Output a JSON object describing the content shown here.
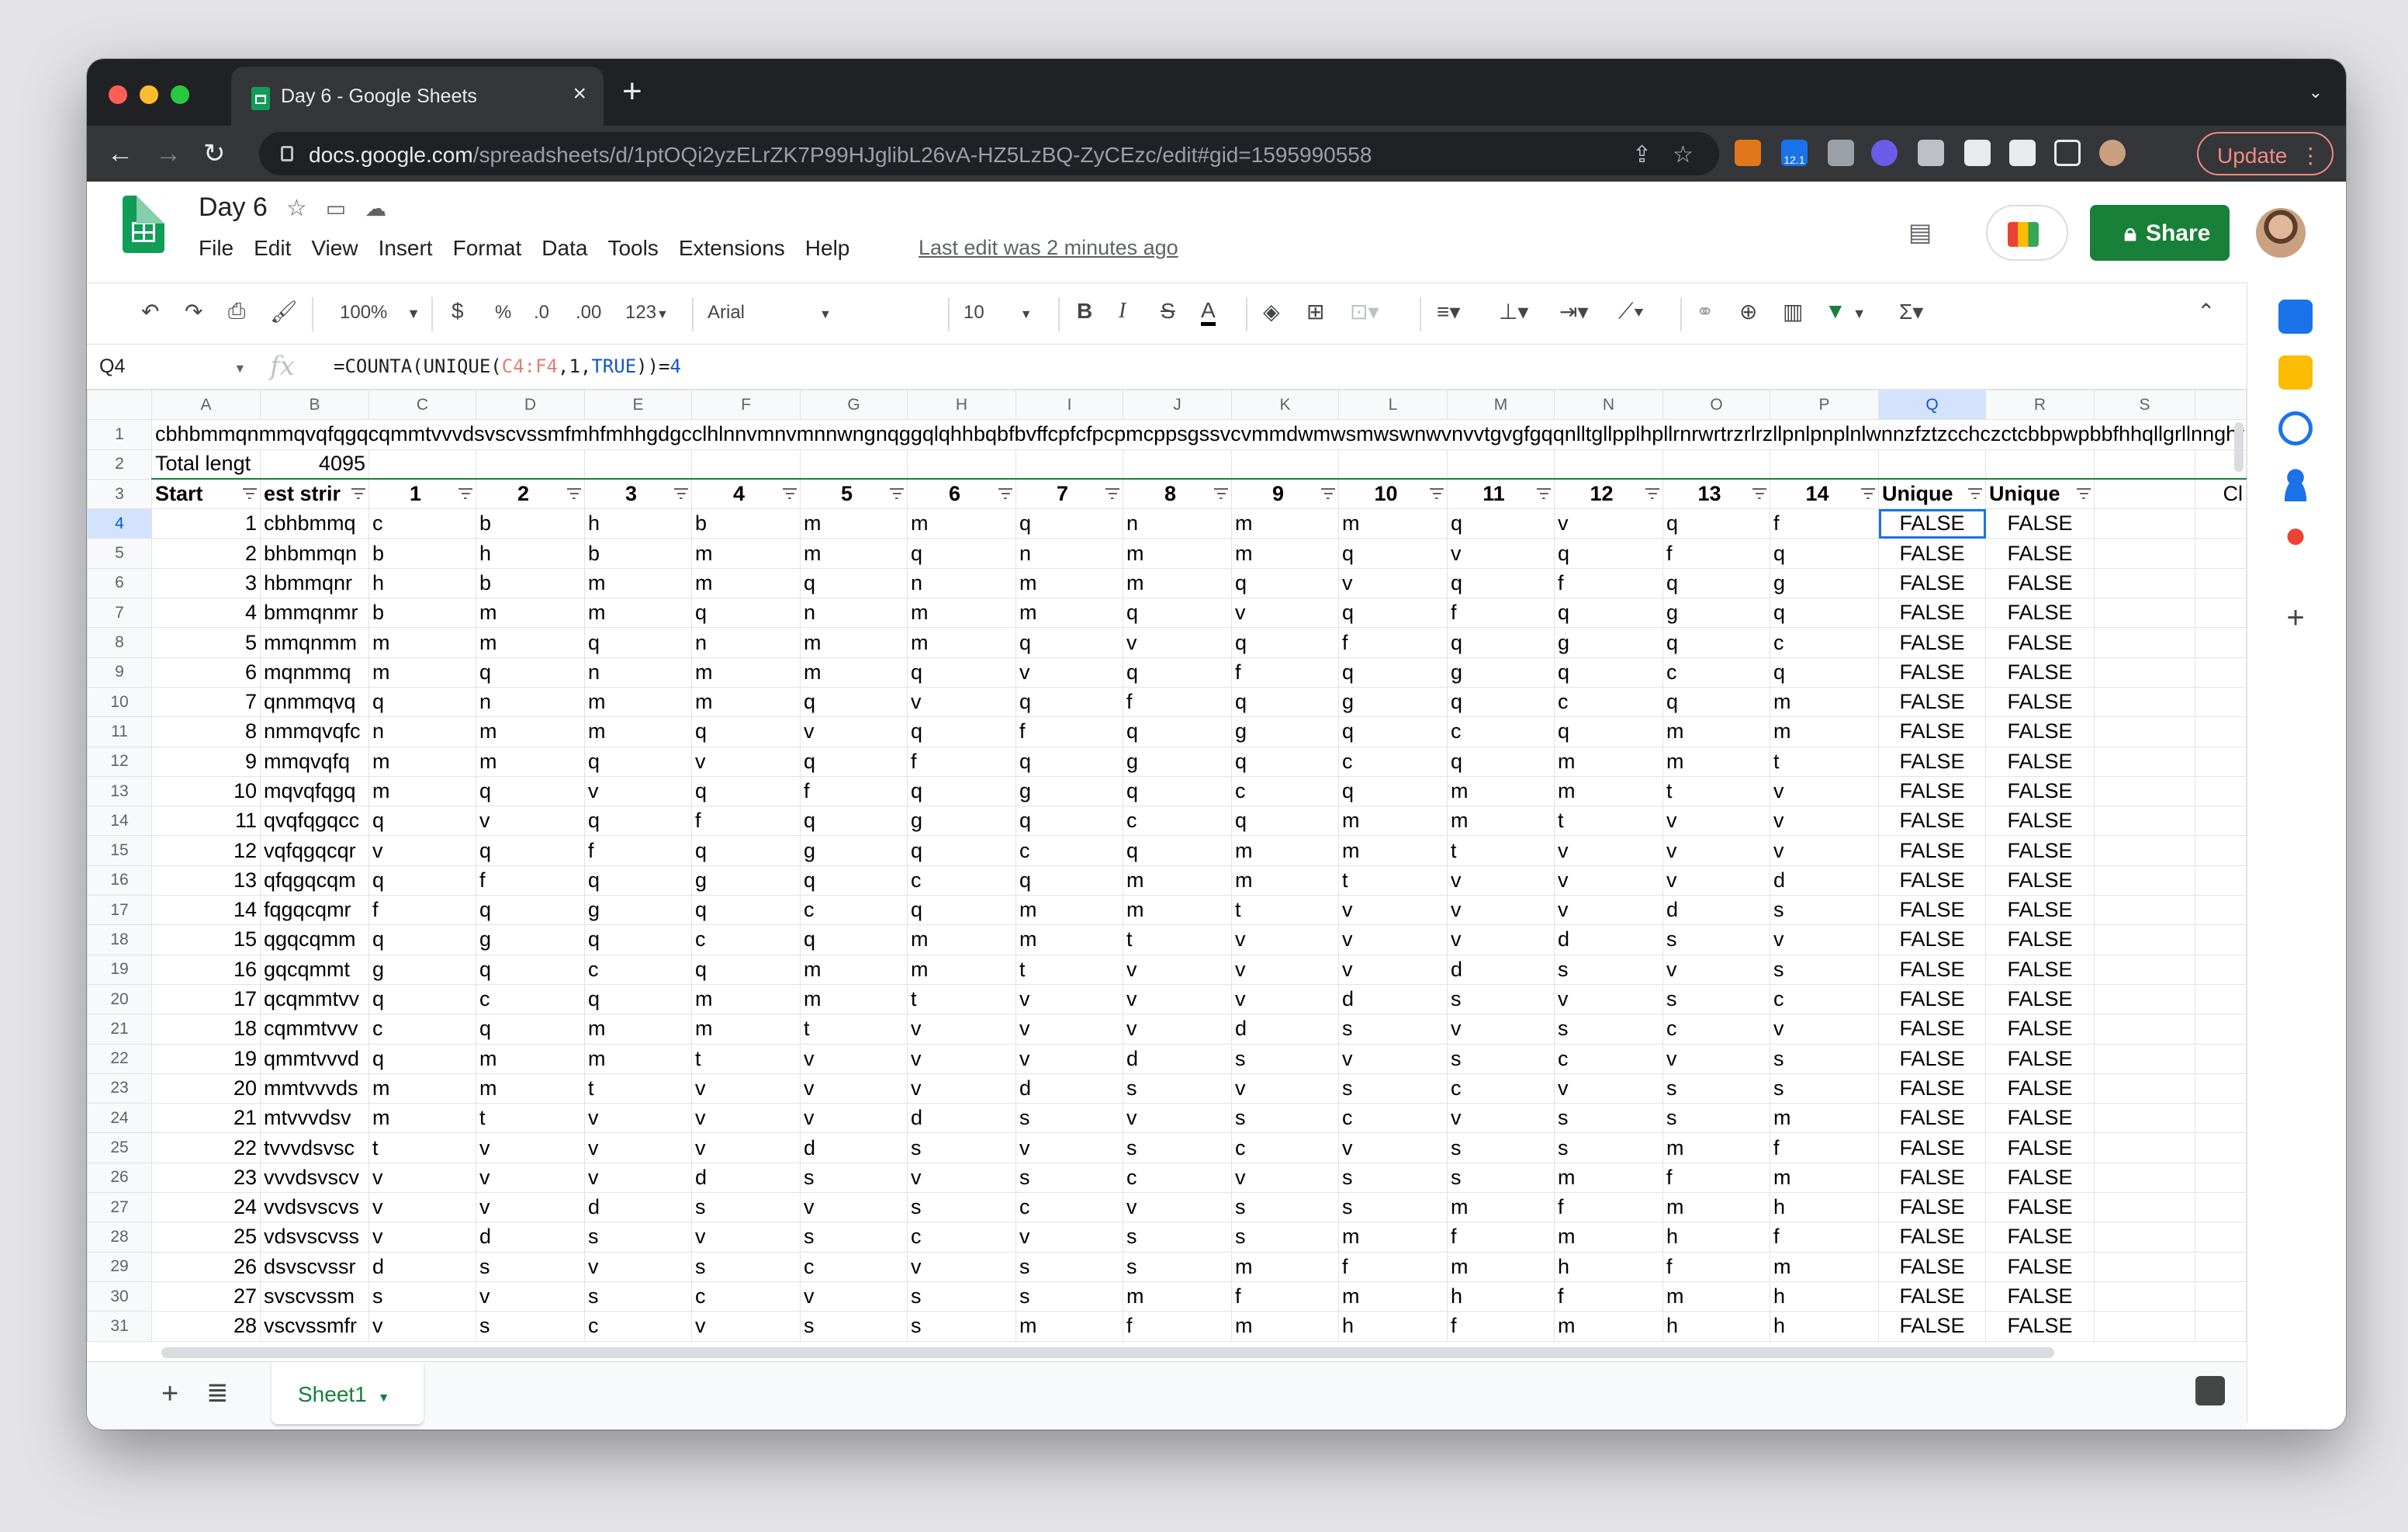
{
  "browser": {
    "tab_title": "Day 6 - Google Sheets",
    "url_host": "docs.google.com",
    "url_path": "/spreadsheets/d/1ptOQi2yzELrZK7P99HJglibL26vA-HZ5LzBQ-ZyCEzc/edit#gid=1595990558",
    "update_label": "Update",
    "ext_badge": "12.1"
  },
  "doc": {
    "title": "Day 6",
    "menus": [
      "File",
      "Edit",
      "View",
      "Insert",
      "Format",
      "Data",
      "Tools",
      "Extensions",
      "Help"
    ],
    "last_edit": "Last edit was 2 minutes ago",
    "share_label": "Share"
  },
  "format_bar": {
    "zoom": "100%",
    "currency": "$",
    "percent": "%",
    "dec_less": ".0",
    "dec_more": ".00",
    "more_formats": "123",
    "font": "Arial",
    "font_size": "10"
  },
  "formula_bar": {
    "cell_ref": "Q4",
    "fx": "fx",
    "formula_prefix": "=COUNTA(UNIQUE(",
    "formula_ref": "C4:F4",
    "formula_mid": ",1,",
    "formula_bool": "TRUE",
    "formula_end": "))=",
    "formula_num": "4"
  },
  "grid": {
    "columns": [
      "A",
      "B",
      "C",
      "D",
      "E",
      "F",
      "G",
      "H",
      "I",
      "J",
      "K",
      "L",
      "M",
      "N",
      "O",
      "P",
      "Q",
      "R",
      "S"
    ],
    "row1_text": "cbhbmmqnmmqvqfqgqcqmmtvvvdsvscvssmfmhfmhhgdgcclhlnnvmnvmnnwngnqggqlqhhbqbfbvffcpfcfpcpmcppsgssvcvmmdwmwsmwswnwvnvvtgvgfgqqnlltgllpplhpllrnrwrtrzrlrzllpnlpnplnlwnnzfztzcchczctcbbpwpbbfhhqllgrllnnghrrnrjjtdttvwvnnbnzzcdcsdsnddlnddtmdmsmnmsmsnnjsnnhppzbzbfbzzmlltmmhlhbhggnmmwccqsqsgggs",
    "row2_label": "Total lengt",
    "row2_value": "4095",
    "headers": [
      "Start",
      "est strir",
      "1",
      "2",
      "3",
      "4",
      "5",
      "6",
      "7",
      "8",
      "9",
      "10",
      "11",
      "12",
      "13",
      "14",
      "Unique",
      "Unique"
    ],
    "header_extra": "Cl",
    "rows": [
      [
        "1",
        "cbhbmmq",
        "c",
        "b",
        "h",
        "b",
        "m",
        "m",
        "q",
        "n",
        "m",
        "m",
        "q",
        "v",
        "q",
        "f",
        "FALSE",
        "FALSE"
      ],
      [
        "2",
        "bhbmmqn",
        "b",
        "h",
        "b",
        "m",
        "m",
        "q",
        "n",
        "m",
        "m",
        "q",
        "v",
        "q",
        "f",
        "q",
        "FALSE",
        "FALSE"
      ],
      [
        "3",
        "hbmmqnr",
        "h",
        "b",
        "m",
        "m",
        "q",
        "n",
        "m",
        "m",
        "q",
        "v",
        "q",
        "f",
        "q",
        "g",
        "FALSE",
        "FALSE"
      ],
      [
        "4",
        "bmmqnmr",
        "b",
        "m",
        "m",
        "q",
        "n",
        "m",
        "m",
        "q",
        "v",
        "q",
        "f",
        "q",
        "g",
        "q",
        "FALSE",
        "FALSE"
      ],
      [
        "5",
        "mmqnmm",
        "m",
        "m",
        "q",
        "n",
        "m",
        "m",
        "q",
        "v",
        "q",
        "f",
        "q",
        "g",
        "q",
        "c",
        "FALSE",
        "FALSE"
      ],
      [
        "6",
        "mqnmmq",
        "m",
        "q",
        "n",
        "m",
        "m",
        "q",
        "v",
        "q",
        "f",
        "q",
        "g",
        "q",
        "c",
        "q",
        "FALSE",
        "FALSE"
      ],
      [
        "7",
        "qnmmqvq",
        "q",
        "n",
        "m",
        "m",
        "q",
        "v",
        "q",
        "f",
        "q",
        "g",
        "q",
        "c",
        "q",
        "m",
        "FALSE",
        "FALSE"
      ],
      [
        "8",
        "nmmqvqfc",
        "n",
        "m",
        "m",
        "q",
        "v",
        "q",
        "f",
        "q",
        "g",
        "q",
        "c",
        "q",
        "m",
        "m",
        "FALSE",
        "FALSE"
      ],
      [
        "9",
        "mmqvqfq",
        "m",
        "m",
        "q",
        "v",
        "q",
        "f",
        "q",
        "g",
        "q",
        "c",
        "q",
        "m",
        "m",
        "t",
        "FALSE",
        "FALSE"
      ],
      [
        "10",
        "mqvqfqgq",
        "m",
        "q",
        "v",
        "q",
        "f",
        "q",
        "g",
        "q",
        "c",
        "q",
        "m",
        "m",
        "t",
        "v",
        "FALSE",
        "FALSE"
      ],
      [
        "11",
        "qvqfqgqcc",
        "q",
        "v",
        "q",
        "f",
        "q",
        "g",
        "q",
        "c",
        "q",
        "m",
        "m",
        "t",
        "v",
        "v",
        "FALSE",
        "FALSE"
      ],
      [
        "12",
        "vqfqgqcqr",
        "v",
        "q",
        "f",
        "q",
        "g",
        "q",
        "c",
        "q",
        "m",
        "m",
        "t",
        "v",
        "v",
        "v",
        "FALSE",
        "FALSE"
      ],
      [
        "13",
        "qfqgqcqm",
        "q",
        "f",
        "q",
        "g",
        "q",
        "c",
        "q",
        "m",
        "m",
        "t",
        "v",
        "v",
        "v",
        "d",
        "FALSE",
        "FALSE"
      ],
      [
        "14",
        "fqgqcqmr",
        "f",
        "q",
        "g",
        "q",
        "c",
        "q",
        "m",
        "m",
        "t",
        "v",
        "v",
        "v",
        "d",
        "s",
        "FALSE",
        "FALSE"
      ],
      [
        "15",
        "qgqcqmm",
        "q",
        "g",
        "q",
        "c",
        "q",
        "m",
        "m",
        "t",
        "v",
        "v",
        "v",
        "d",
        "s",
        "v",
        "FALSE",
        "FALSE"
      ],
      [
        "16",
        "gqcqmmt",
        "g",
        "q",
        "c",
        "q",
        "m",
        "m",
        "t",
        "v",
        "v",
        "v",
        "d",
        "s",
        "v",
        "s",
        "FALSE",
        "FALSE"
      ],
      [
        "17",
        "qcqmmtvv",
        "q",
        "c",
        "q",
        "m",
        "m",
        "t",
        "v",
        "v",
        "v",
        "d",
        "s",
        "v",
        "s",
        "c",
        "FALSE",
        "FALSE"
      ],
      [
        "18",
        "cqmmtvvv",
        "c",
        "q",
        "m",
        "m",
        "t",
        "v",
        "v",
        "v",
        "d",
        "s",
        "v",
        "s",
        "c",
        "v",
        "FALSE",
        "FALSE"
      ],
      [
        "19",
        "qmmtvvvd",
        "q",
        "m",
        "m",
        "t",
        "v",
        "v",
        "v",
        "d",
        "s",
        "v",
        "s",
        "c",
        "v",
        "s",
        "FALSE",
        "FALSE"
      ],
      [
        "20",
        "mmtvvvds",
        "m",
        "m",
        "t",
        "v",
        "v",
        "v",
        "d",
        "s",
        "v",
        "s",
        "c",
        "v",
        "s",
        "s",
        "FALSE",
        "FALSE"
      ],
      [
        "21",
        "mtvvvdsv",
        "m",
        "t",
        "v",
        "v",
        "v",
        "d",
        "s",
        "v",
        "s",
        "c",
        "v",
        "s",
        "s",
        "m",
        "FALSE",
        "FALSE"
      ],
      [
        "22",
        "tvvvdsvsc",
        "t",
        "v",
        "v",
        "v",
        "d",
        "s",
        "v",
        "s",
        "c",
        "v",
        "s",
        "s",
        "m",
        "f",
        "FALSE",
        "FALSE"
      ],
      [
        "23",
        "vvvdsvscv",
        "v",
        "v",
        "v",
        "d",
        "s",
        "v",
        "s",
        "c",
        "v",
        "s",
        "s",
        "m",
        "f",
        "m",
        "FALSE",
        "FALSE"
      ],
      [
        "24",
        "vvdsvscvs",
        "v",
        "v",
        "d",
        "s",
        "v",
        "s",
        "c",
        "v",
        "s",
        "s",
        "m",
        "f",
        "m",
        "h",
        "FALSE",
        "FALSE"
      ],
      [
        "25",
        "vdsvscvss",
        "v",
        "d",
        "s",
        "v",
        "s",
        "c",
        "v",
        "s",
        "s",
        "m",
        "f",
        "m",
        "h",
        "f",
        "FALSE",
        "FALSE"
      ],
      [
        "26",
        "dsvscvssr",
        "d",
        "s",
        "v",
        "s",
        "c",
        "v",
        "s",
        "s",
        "m",
        "f",
        "m",
        "h",
        "f",
        "m",
        "FALSE",
        "FALSE"
      ],
      [
        "27",
        "svscvssm",
        "s",
        "v",
        "s",
        "c",
        "v",
        "s",
        "s",
        "m",
        "f",
        "m",
        "h",
        "f",
        "m",
        "h",
        "FALSE",
        "FALSE"
      ],
      [
        "28",
        "vscvssmfr",
        "v",
        "s",
        "c",
        "v",
        "s",
        "s",
        "m",
        "f",
        "m",
        "h",
        "f",
        "m",
        "h",
        "h",
        "FALSE",
        "FALSE"
      ]
    ]
  },
  "sheet": {
    "tab_label": "Sheet1"
  }
}
